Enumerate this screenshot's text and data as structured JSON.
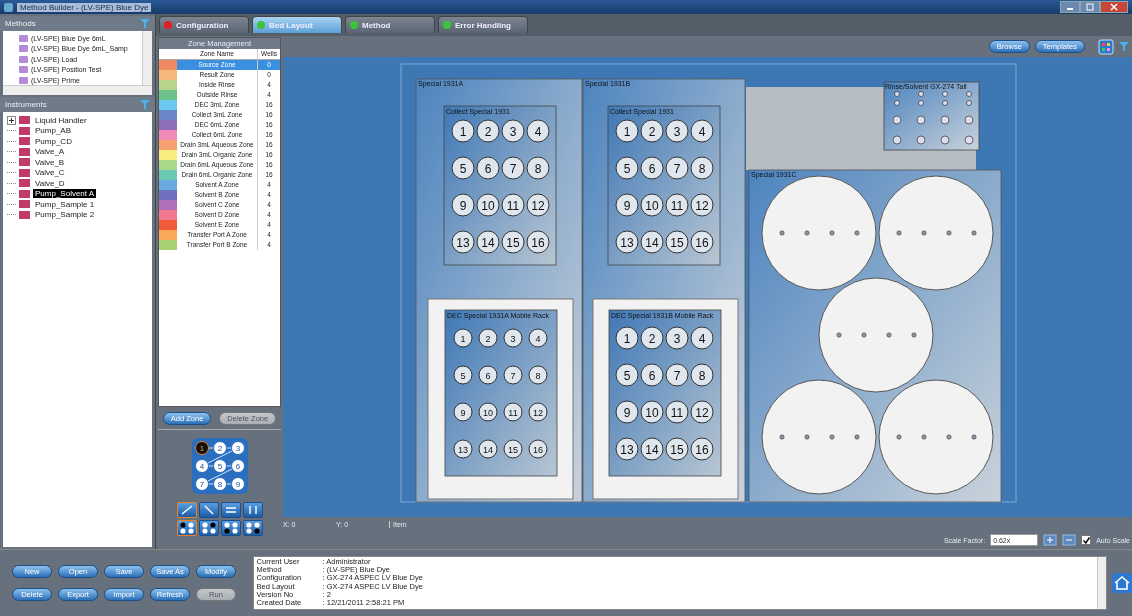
{
  "window": {
    "title": "Method Builder - (LV-SPE) Blue Dye"
  },
  "methods": {
    "title": "Methods",
    "items": [
      {
        "label": "(LV-SPE) Blue Dye 6mL"
      },
      {
        "label": "(LV-SPE) Blue Dye 6mL_Samp"
      },
      {
        "label": "(LV-SPE) Load"
      },
      {
        "label": "(LV-SPE) Position Test"
      },
      {
        "label": "(LV-SPE) Prime"
      }
    ]
  },
  "instruments": {
    "title": "Instruments",
    "items": [
      {
        "label": "Liquid Handler",
        "expanded": false,
        "selected": false
      },
      {
        "label": "Pump_AB",
        "selected": false
      },
      {
        "label": "Pump_CD",
        "selected": false
      },
      {
        "label": "Valve_A",
        "selected": false
      },
      {
        "label": "Valve_B",
        "selected": false
      },
      {
        "label": "Valve_C",
        "selected": false
      },
      {
        "label": "Valve_D",
        "selected": false
      },
      {
        "label": "Pump_Solvent A",
        "selected": true
      },
      {
        "label": "Pump_Sample 1",
        "selected": false
      },
      {
        "label": "Pump_Sample 2",
        "selected": false
      }
    ]
  },
  "tabs": [
    {
      "label": "Configuration",
      "selected": false,
      "color": "#e02020"
    },
    {
      "label": "Bed Layout",
      "selected": true,
      "color": "#3cc43c"
    },
    {
      "label": "Method",
      "selected": false,
      "color": "#3cc43c"
    },
    {
      "label": "Error Handling",
      "selected": false,
      "color": "#3cc43c"
    }
  ],
  "zone_management": {
    "title": "Zone Management",
    "columns": [
      "Zone Name",
      "Wells"
    ],
    "rows": [
      {
        "name": "Source Zone",
        "wells": "0",
        "color": "#f08a62",
        "selected": true
      },
      {
        "name": "Result Zone",
        "wells": "0",
        "color": "#f5b77a",
        "selected": false
      },
      {
        "name": "Inside Rinse",
        "wells": "4",
        "color": "#b8d48a",
        "selected": false
      },
      {
        "name": "Outside Rinse",
        "wells": "4",
        "color": "#6cc28a",
        "selected": false
      },
      {
        "name": "DEC 3mL Zone",
        "wells": "16",
        "color": "#6bc8ee",
        "selected": false
      },
      {
        "name": "Collect 3mL Zone",
        "wells": "16",
        "color": "#6a86c8",
        "selected": false
      },
      {
        "name": "DEC 6mL Zone",
        "wells": "16",
        "color": "#8c6fb8",
        "selected": false
      },
      {
        "name": "Collect 6mL Zone",
        "wells": "16",
        "color": "#f08ab8",
        "selected": false
      },
      {
        "name": "Drain 3mL Aqueous Zone",
        "wells": "16",
        "color": "#f4a070",
        "selected": false
      },
      {
        "name": "Drain 3mL Organic Zone",
        "wells": "16",
        "color": "#f8ee80",
        "selected": false
      },
      {
        "name": "Drain 6mL Aqueous Zone",
        "wells": "16",
        "color": "#a8d88a",
        "selected": false
      },
      {
        "name": "Drain 6mL Organic Zone",
        "wells": "16",
        "color": "#6cc8b0",
        "selected": false
      },
      {
        "name": "Solvent A Zone",
        "wells": "4",
        "color": "#6aa8e0",
        "selected": false
      },
      {
        "name": "Solvent B Zone",
        "wells": "4",
        "color": "#7070c0",
        "selected": false
      },
      {
        "name": "Solvent C Zone",
        "wells": "4",
        "color": "#b070b8",
        "selected": false
      },
      {
        "name": "Solvent D Zone",
        "wells": "4",
        "color": "#f07890",
        "selected": false
      },
      {
        "name": "Solvent E Zone",
        "wells": "4",
        "color": "#f05a3a",
        "selected": false
      },
      {
        "name": "Transfer Port A Zone",
        "wells": "4",
        "color": "#f8a858",
        "selected": false
      },
      {
        "name": "Transfer Port B Zone",
        "wells": "4",
        "color": "#a8d070",
        "selected": false
      }
    ],
    "buttons": [
      {
        "label": "Add Zone",
        "disabled": false
      },
      {
        "label": "Delete Zone",
        "disabled": true
      }
    ]
  },
  "sequence_preview": [
    "1",
    "2",
    "3",
    "4",
    "5",
    "6",
    "7",
    "8",
    "9"
  ],
  "fill_directions": [
    {
      "selected": true
    },
    {
      "selected": false
    },
    {
      "selected": false
    },
    {
      "selected": false
    }
  ],
  "start_corners": [
    {
      "selected": true
    },
    {
      "selected": false
    },
    {
      "selected": false
    },
    {
      "selected": false
    }
  ],
  "toolbar": {
    "buttons": [
      "Browse",
      "Templates"
    ]
  },
  "racks": [
    {
      "name": "Special 1931A",
      "collect": {
        "name": "Collect Special 1931",
        "wells": [
          "1",
          "2",
          "3",
          "4",
          "5",
          "6",
          "7",
          "8",
          "9",
          "10",
          "11",
          "12",
          "13",
          "14",
          "15",
          "16"
        ]
      },
      "mobile": {
        "name": "DEC Special 1931A Mobile Rack",
        "wells": [
          "1",
          "2",
          "3",
          "4",
          "5",
          "6",
          "7",
          "8",
          "9",
          "10",
          "11",
          "12",
          "13",
          "14",
          "15",
          "16"
        ]
      }
    },
    {
      "name": "Special 1931B",
      "collect": {
        "name": "Collect Special 1931",
        "wells": [
          "1",
          "2",
          "3",
          "4",
          "5",
          "6",
          "7",
          "8",
          "9",
          "10",
          "11",
          "12",
          "13",
          "14",
          "15",
          "16"
        ]
      },
      "mobile": {
        "name": "DEC Special 1931B Mobile Rack",
        "wells": [
          "1",
          "2",
          "3",
          "4",
          "5",
          "6",
          "7",
          "8",
          "9",
          "10",
          "11",
          "12",
          "13",
          "14",
          "15",
          "16"
        ]
      }
    }
  ],
  "rinse_rack": {
    "name": "Rinse/Solvent GX-274 Tall"
  },
  "bottle_rack": {
    "name": "Special 1931C"
  },
  "status": {
    "x": "X: 0",
    "y": "Y: 0",
    "item": "Item"
  },
  "scale": {
    "label": "Scale Factor:",
    "value": "0.62x",
    "auto_scale": {
      "label": "Auto Scale",
      "checked": true
    }
  },
  "actions": [
    {
      "label": "New",
      "disabled": false
    },
    {
      "label": "Open",
      "disabled": false
    },
    {
      "label": "Save",
      "disabled": false
    },
    {
      "label": "Save As",
      "disabled": false
    },
    {
      "label": "Modify",
      "disabled": false
    },
    {
      "label": "Delete",
      "disabled": false
    },
    {
      "label": "Export",
      "disabled": false
    },
    {
      "label": "Import",
      "disabled": false
    },
    {
      "label": "Refresh",
      "disabled": false
    },
    {
      "label": "Run",
      "disabled": true
    }
  ],
  "info": [
    {
      "label": "Current User",
      "value": ": Administrator"
    },
    {
      "label": "Method",
      "value": ": (LV-SPE) Blue Dye"
    },
    {
      "label": "Configuration",
      "value": ": GX-274 ASPEC LV Blue Dye"
    },
    {
      "label": "Bed Layout",
      "value": ": GX-274 ASPEC LV Blue Dye"
    },
    {
      "label": "Version No",
      "value": ": 2"
    },
    {
      "label": "Created Date",
      "value": ": 12/21/2011 2:58:21 PM"
    }
  ]
}
